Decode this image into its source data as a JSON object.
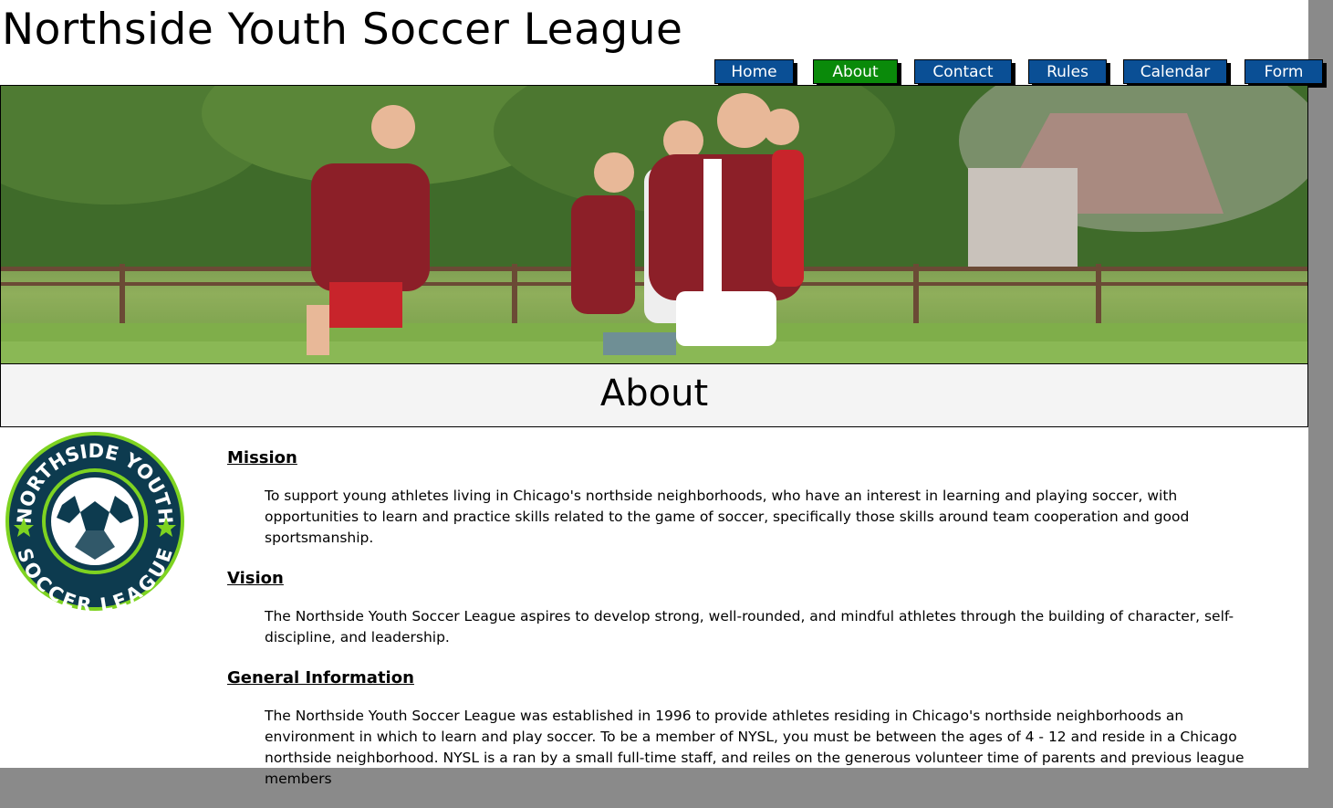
{
  "site": {
    "title": "Northside Youth Soccer League"
  },
  "nav": {
    "items": [
      {
        "label": "Home",
        "active": false
      },
      {
        "label": "About",
        "active": true
      },
      {
        "label": "Contact",
        "active": false
      },
      {
        "label": "Rules",
        "active": false
      },
      {
        "label": "Calendar",
        "active": false
      },
      {
        "label": "Form",
        "active": false
      }
    ]
  },
  "hero": {
    "image": "kids-playing-soccer-photo"
  },
  "page": {
    "heading": "About"
  },
  "logo": {
    "top_text": "NORTHSIDE YOUTH",
    "bottom_text": "SOCCER LEAGUE"
  },
  "sections": [
    {
      "title": "Mission",
      "text": "To support young athletes living in Chicago's northside neighborhoods, who have an interest in learning and playing soccer, with opportunities to learn and practice skills related to the game of soccer, specifically those skills around team cooperation and good sportsmanship."
    },
    {
      "title": "Vision",
      "text": "The Northside Youth Soccer League aspires to develop strong, well-rounded, and mindful athletes through the building of character, self-discipline, and leadership."
    },
    {
      "title": "General Information",
      "text": "The Northside Youth Soccer League was established in 1996 to provide athletes residing in Chicago's northside neighborhoods an environment in which to learn and play soccer. To be a member of NYSL, you must be between the ages of 4 - 12 and reside in a Chicago northside neighborhood. NYSL is a ran by a small full-time staff, and reiles on the generous volunteer time of parents and previous league members"
    }
  ],
  "colors": {
    "nav_bg": "#0a4f95",
    "nav_active": "#0a8a0a",
    "logo_ring": "#7ed321",
    "logo_navy": "#0d3b4f"
  }
}
